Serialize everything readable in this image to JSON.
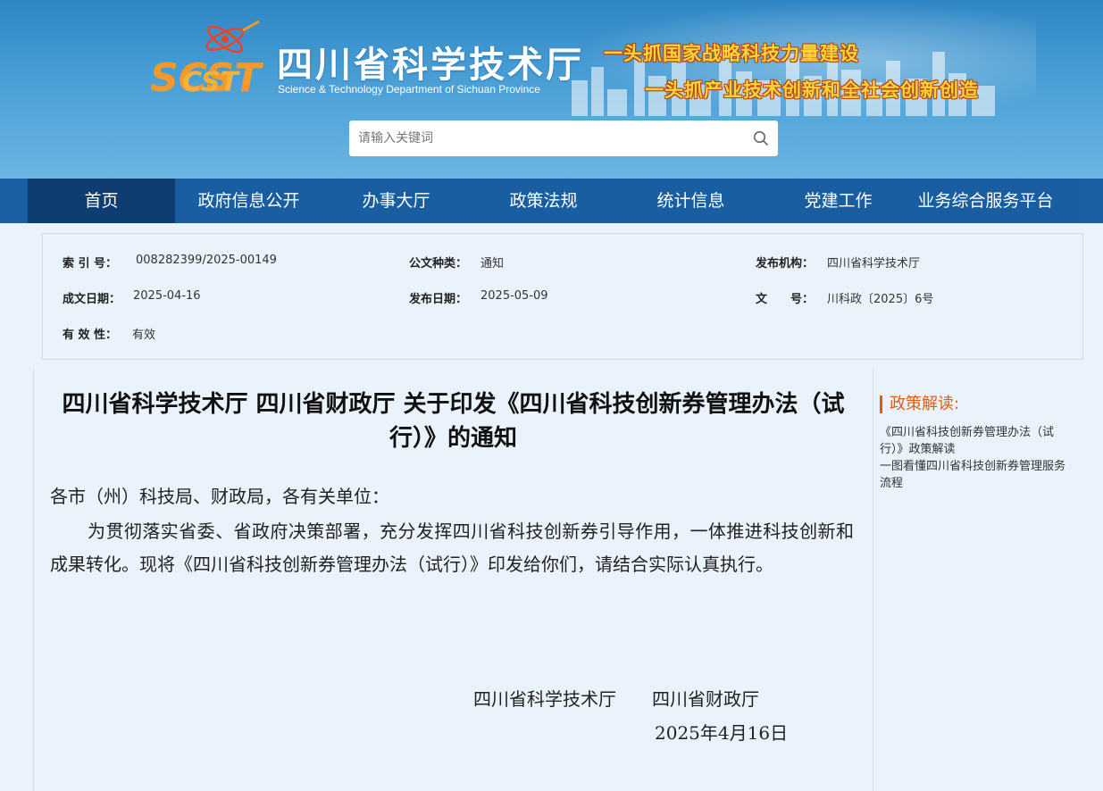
{
  "header": {
    "org_name_cn": "四川省科学技术厅",
    "org_name_en": "Science & Technology Department of Sichuan Province",
    "logo_text": "SCST",
    "slogan_1": "一头抓国家战略科技力量建设",
    "slogan_2": "一头抓产业技术创新和全社会创新创造",
    "search": {
      "placeholder": "请输入关键词",
      "icon": "search-icon"
    }
  },
  "nav": {
    "items": [
      {
        "label": "首页",
        "active": true
      },
      {
        "label": "政府信息公开"
      },
      {
        "label": "办事大厅"
      },
      {
        "label": "政策法规"
      },
      {
        "label": "统计信息"
      },
      {
        "label": "党建工作"
      },
      {
        "label": "业务综合服务平台"
      }
    ]
  },
  "meta": {
    "index_no": {
      "label": "索 引 号：",
      "value": "008282399/2025-00149"
    },
    "doc_type": {
      "label": "公文种类：",
      "value": "通知"
    },
    "publisher": {
      "label": "发布机构：",
      "value": "四川省科学技术厅"
    },
    "written_date": {
      "label": "成文日期：",
      "value": "2025-04-16"
    },
    "publish_date": {
      "label": "发布日期：",
      "value": "2025-05-09"
    },
    "doc_no": {
      "label": "文　　号：",
      "value": "川科政〔2025〕6号"
    },
    "validity": {
      "label": "有 效 性：",
      "value": "有效"
    }
  },
  "document": {
    "title": "四川省科学技术厅 四川省财政厅 关于印发《四川省科技创新券管理办法（试行）》的通知",
    "salutation": "各市（州）科技局、财政局，各有关单位：",
    "paragraph": "为贯彻落实省委、省政府决策部署，充分发挥四川省科技创新券引导作用，一体推进科技创新和成果转化。现将《四川省科技创新券管理办法（试行）》印发给你们，请结合实际认真执行。",
    "signature_orgs": "四川省科学技术厅　　四川省财政厅",
    "signature_date": "2025年4月16日"
  },
  "sidebar": {
    "heading": "政策解读:",
    "links": [
      "《四川省科技创新券管理办法（试行）》政策解读",
      "一图看懂四川省科技创新券管理服务流程"
    ]
  },
  "colors": {
    "nav_bg": "#1a5ea2",
    "nav_active": "#0e3d72",
    "accent": "#e35a13",
    "slogan": "#ffd43a",
    "page_bg": "#eaf3fb"
  }
}
